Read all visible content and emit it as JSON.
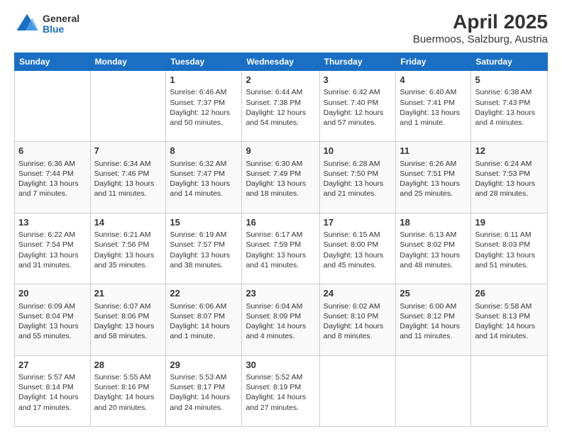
{
  "header": {
    "logo_general": "General",
    "logo_blue": "Blue",
    "title": "April 2025",
    "subtitle": "Buermoos, Salzburg, Austria"
  },
  "days_of_week": [
    "Sunday",
    "Monday",
    "Tuesday",
    "Wednesday",
    "Thursday",
    "Friday",
    "Saturday"
  ],
  "weeks": [
    [
      {
        "day": "",
        "lines": []
      },
      {
        "day": "",
        "lines": []
      },
      {
        "day": "1",
        "lines": [
          "Sunrise: 6:46 AM",
          "Sunset: 7:37 PM",
          "Daylight: 12 hours",
          "and 50 minutes."
        ]
      },
      {
        "day": "2",
        "lines": [
          "Sunrise: 6:44 AM",
          "Sunset: 7:38 PM",
          "Daylight: 12 hours",
          "and 54 minutes."
        ]
      },
      {
        "day": "3",
        "lines": [
          "Sunrise: 6:42 AM",
          "Sunset: 7:40 PM",
          "Daylight: 12 hours",
          "and 57 minutes."
        ]
      },
      {
        "day": "4",
        "lines": [
          "Sunrise: 6:40 AM",
          "Sunset: 7:41 PM",
          "Daylight: 13 hours",
          "and 1 minute."
        ]
      },
      {
        "day": "5",
        "lines": [
          "Sunrise: 6:38 AM",
          "Sunset: 7:43 PM",
          "Daylight: 13 hours",
          "and 4 minutes."
        ]
      }
    ],
    [
      {
        "day": "6",
        "lines": [
          "Sunrise: 6:36 AM",
          "Sunset: 7:44 PM",
          "Daylight: 13 hours",
          "and 7 minutes."
        ]
      },
      {
        "day": "7",
        "lines": [
          "Sunrise: 6:34 AM",
          "Sunset: 7:46 PM",
          "Daylight: 13 hours",
          "and 11 minutes."
        ]
      },
      {
        "day": "8",
        "lines": [
          "Sunrise: 6:32 AM",
          "Sunset: 7:47 PM",
          "Daylight: 13 hours",
          "and 14 minutes."
        ]
      },
      {
        "day": "9",
        "lines": [
          "Sunrise: 6:30 AM",
          "Sunset: 7:49 PM",
          "Daylight: 13 hours",
          "and 18 minutes."
        ]
      },
      {
        "day": "10",
        "lines": [
          "Sunrise: 6:28 AM",
          "Sunset: 7:50 PM",
          "Daylight: 13 hours",
          "and 21 minutes."
        ]
      },
      {
        "day": "11",
        "lines": [
          "Sunrise: 6:26 AM",
          "Sunset: 7:51 PM",
          "Daylight: 13 hours",
          "and 25 minutes."
        ]
      },
      {
        "day": "12",
        "lines": [
          "Sunrise: 6:24 AM",
          "Sunset: 7:53 PM",
          "Daylight: 13 hours",
          "and 28 minutes."
        ]
      }
    ],
    [
      {
        "day": "13",
        "lines": [
          "Sunrise: 6:22 AM",
          "Sunset: 7:54 PM",
          "Daylight: 13 hours",
          "and 31 minutes."
        ]
      },
      {
        "day": "14",
        "lines": [
          "Sunrise: 6:21 AM",
          "Sunset: 7:56 PM",
          "Daylight: 13 hours",
          "and 35 minutes."
        ]
      },
      {
        "day": "15",
        "lines": [
          "Sunrise: 6:19 AM",
          "Sunset: 7:57 PM",
          "Daylight: 13 hours",
          "and 38 minutes."
        ]
      },
      {
        "day": "16",
        "lines": [
          "Sunrise: 6:17 AM",
          "Sunset: 7:59 PM",
          "Daylight: 13 hours",
          "and 41 minutes."
        ]
      },
      {
        "day": "17",
        "lines": [
          "Sunrise: 6:15 AM",
          "Sunset: 8:00 PM",
          "Daylight: 13 hours",
          "and 45 minutes."
        ]
      },
      {
        "day": "18",
        "lines": [
          "Sunrise: 6:13 AM",
          "Sunset: 8:02 PM",
          "Daylight: 13 hours",
          "and 48 minutes."
        ]
      },
      {
        "day": "19",
        "lines": [
          "Sunrise: 6:11 AM",
          "Sunset: 8:03 PM",
          "Daylight: 13 hours",
          "and 51 minutes."
        ]
      }
    ],
    [
      {
        "day": "20",
        "lines": [
          "Sunrise: 6:09 AM",
          "Sunset: 8:04 PM",
          "Daylight: 13 hours",
          "and 55 minutes."
        ]
      },
      {
        "day": "21",
        "lines": [
          "Sunrise: 6:07 AM",
          "Sunset: 8:06 PM",
          "Daylight: 13 hours",
          "and 58 minutes."
        ]
      },
      {
        "day": "22",
        "lines": [
          "Sunrise: 6:06 AM",
          "Sunset: 8:07 PM",
          "Daylight: 14 hours",
          "and 1 minute."
        ]
      },
      {
        "day": "23",
        "lines": [
          "Sunrise: 6:04 AM",
          "Sunset: 8:09 PM",
          "Daylight: 14 hours",
          "and 4 minutes."
        ]
      },
      {
        "day": "24",
        "lines": [
          "Sunrise: 6:02 AM",
          "Sunset: 8:10 PM",
          "Daylight: 14 hours",
          "and 8 minutes."
        ]
      },
      {
        "day": "25",
        "lines": [
          "Sunrise: 6:00 AM",
          "Sunset: 8:12 PM",
          "Daylight: 14 hours",
          "and 11 minutes."
        ]
      },
      {
        "day": "26",
        "lines": [
          "Sunrise: 5:58 AM",
          "Sunset: 8:13 PM",
          "Daylight: 14 hours",
          "and 14 minutes."
        ]
      }
    ],
    [
      {
        "day": "27",
        "lines": [
          "Sunrise: 5:57 AM",
          "Sunset: 8:14 PM",
          "Daylight: 14 hours",
          "and 17 minutes."
        ]
      },
      {
        "day": "28",
        "lines": [
          "Sunrise: 5:55 AM",
          "Sunset: 8:16 PM",
          "Daylight: 14 hours",
          "and 20 minutes."
        ]
      },
      {
        "day": "29",
        "lines": [
          "Sunrise: 5:53 AM",
          "Sunset: 8:17 PM",
          "Daylight: 14 hours",
          "and 24 minutes."
        ]
      },
      {
        "day": "30",
        "lines": [
          "Sunrise: 5:52 AM",
          "Sunset: 8:19 PM",
          "Daylight: 14 hours",
          "and 27 minutes."
        ]
      },
      {
        "day": "",
        "lines": []
      },
      {
        "day": "",
        "lines": []
      },
      {
        "day": "",
        "lines": []
      }
    ]
  ]
}
